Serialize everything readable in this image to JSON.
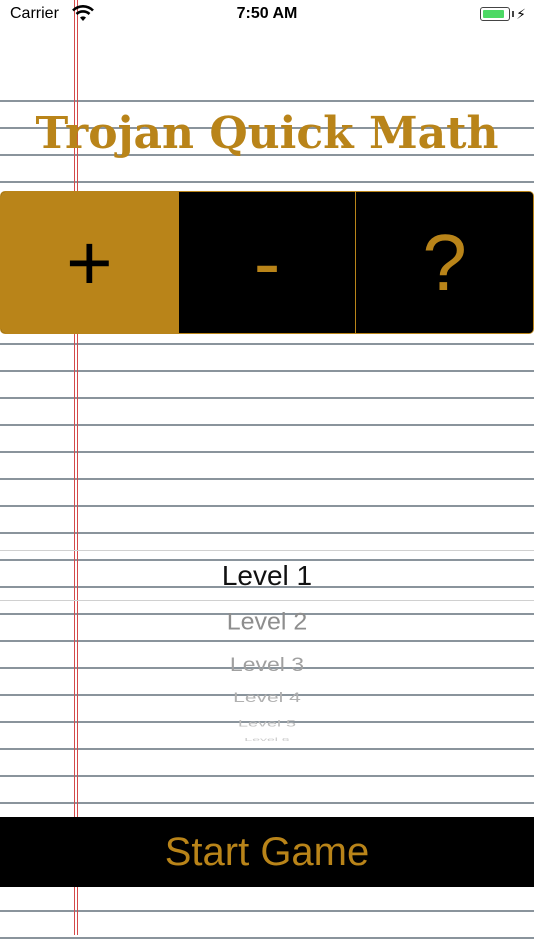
{
  "status_bar": {
    "carrier": "Carrier",
    "time": "7:50 AM",
    "battery_level": 0.8
  },
  "app": {
    "title": "Trojan Quick Math",
    "accent_color": "#b98419"
  },
  "operations": [
    {
      "label": "+",
      "selected": true
    },
    {
      "label": "-",
      "selected": false
    },
    {
      "label": "?",
      "selected": false
    }
  ],
  "level_picker": {
    "selected": "Level 1",
    "options": [
      "Level 1",
      "Level 2",
      "Level 3",
      "Level 4",
      "Level 5",
      "Level 6"
    ]
  },
  "start_button": {
    "label": "Start Game"
  }
}
